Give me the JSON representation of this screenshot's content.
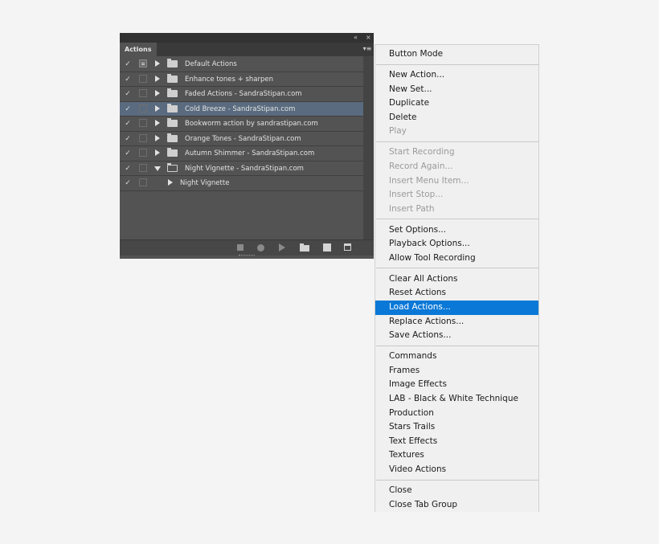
{
  "panel": {
    "title": "Actions",
    "collapse_glyph": "«",
    "close_glyph": "×",
    "menu_glyph": "▾≡",
    "rows": [
      {
        "label": "Default Actions",
        "checked": true,
        "dialog": true,
        "expanded": false,
        "selected": false
      },
      {
        "label": "Enhance tones + sharpen",
        "checked": true,
        "dialog": false,
        "expanded": false,
        "selected": false
      },
      {
        "label": "Faded Actions - SandraStipan.com",
        "checked": true,
        "dialog": false,
        "expanded": false,
        "selected": false
      },
      {
        "label": "Cold Breeze - SandraStipan.com",
        "checked": true,
        "dialog": false,
        "expanded": false,
        "selected": true
      },
      {
        "label": "Bookworm action by sandrastipan.com",
        "checked": true,
        "dialog": false,
        "expanded": false,
        "selected": false
      },
      {
        "label": "Orange Tones  - SandraStipan.com",
        "checked": true,
        "dialog": false,
        "expanded": false,
        "selected": false
      },
      {
        "label": "Autumn Shimmer - SandraStipan.com",
        "checked": true,
        "dialog": false,
        "expanded": false,
        "selected": false
      },
      {
        "label": "Night Vignette - SandraStipan.com",
        "checked": true,
        "dialog": false,
        "expanded": true,
        "selected": false
      },
      {
        "label": "Night Vignette",
        "checked": true,
        "dialog": false,
        "child": true,
        "selected": false
      }
    ],
    "check_glyph": "✓",
    "bottom_icons": [
      "stop-icon",
      "record-icon",
      "play-icon",
      "new-set-icon",
      "new-action-icon",
      "delete-icon"
    ]
  },
  "menu": {
    "groups": [
      [
        {
          "label": "Button Mode",
          "enabled": true
        }
      ],
      [
        {
          "label": "New Action...",
          "enabled": true
        },
        {
          "label": "New Set...",
          "enabled": true
        },
        {
          "label": "Duplicate",
          "enabled": true
        },
        {
          "label": "Delete",
          "enabled": true
        },
        {
          "label": "Play",
          "enabled": false
        }
      ],
      [
        {
          "label": "Start Recording",
          "enabled": false
        },
        {
          "label": "Record Again...",
          "enabled": false
        },
        {
          "label": "Insert Menu Item...",
          "enabled": false
        },
        {
          "label": "Insert Stop...",
          "enabled": false
        },
        {
          "label": "Insert Path",
          "enabled": false
        }
      ],
      [
        {
          "label": "Set Options...",
          "enabled": true
        },
        {
          "label": "Playback Options...",
          "enabled": true
        },
        {
          "label": "Allow Tool Recording",
          "enabled": true
        }
      ],
      [
        {
          "label": "Clear All Actions",
          "enabled": true
        },
        {
          "label": "Reset Actions",
          "enabled": true
        },
        {
          "label": "Load Actions...",
          "enabled": true,
          "highlighted": true
        },
        {
          "label": "Replace Actions...",
          "enabled": true
        },
        {
          "label": "Save Actions...",
          "enabled": true
        }
      ],
      [
        {
          "label": "Commands",
          "enabled": true
        },
        {
          "label": "Frames",
          "enabled": true
        },
        {
          "label": "Image Effects",
          "enabled": true
        },
        {
          "label": "LAB - Black & White Technique",
          "enabled": true
        },
        {
          "label": "Production",
          "enabled": true
        },
        {
          "label": "Stars Trails",
          "enabled": true
        },
        {
          "label": "Text Effects",
          "enabled": true
        },
        {
          "label": "Textures",
          "enabled": true
        },
        {
          "label": "Video Actions",
          "enabled": true
        }
      ],
      [
        {
          "label": "Close",
          "enabled": true
        },
        {
          "label": "Close Tab Group",
          "enabled": true
        }
      ]
    ]
  },
  "colors": {
    "highlight": "#0a78d7",
    "panel_bg": "#535353",
    "selected_row": "#5a6b7f"
  }
}
